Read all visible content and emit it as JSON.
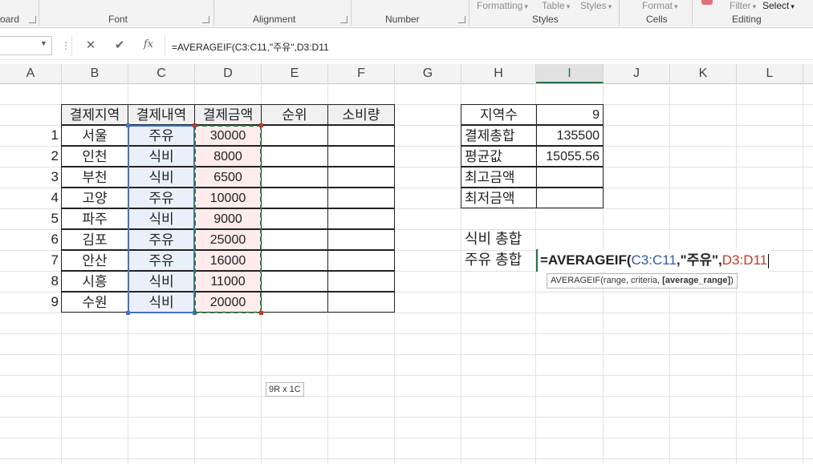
{
  "ribbon": {
    "groups": [
      {
        "label": "oard"
      },
      {
        "label": "Font"
      },
      {
        "label": "Alignment"
      },
      {
        "label": "Number"
      },
      {
        "label": "Styles"
      },
      {
        "label": "Cells"
      },
      {
        "label": "Editing"
      }
    ],
    "styles_buttons": [
      "Formatting",
      "Table",
      "Styles"
    ],
    "cells_button": "Format",
    "editing_buttons": [
      "Filter",
      "Select"
    ]
  },
  "formula_bar": {
    "name_box": "",
    "cancel_glyph": "✕",
    "enter_glyph": "✔",
    "fx_glyph": "fx",
    "formula": "=AVERAGEIF(C3:C11,\"주유\",D3:D11"
  },
  "columns": [
    "A",
    "B",
    "C",
    "D",
    "E",
    "F",
    "G",
    "H",
    "I",
    "J",
    "K",
    "L"
  ],
  "active_column": "I",
  "table": {
    "headers": [
      "결제지역",
      "결제내역",
      "결제금액",
      "순위",
      "소비량"
    ],
    "rows": [
      {
        "no": "1",
        "region": "서울",
        "item": "주유",
        "amount": "30000"
      },
      {
        "no": "2",
        "region": "인천",
        "item": "식비",
        "amount": "8000"
      },
      {
        "no": "3",
        "region": "부천",
        "item": "식비",
        "amount": "6500"
      },
      {
        "no": "4",
        "region": "고양",
        "item": "주유",
        "amount": "10000"
      },
      {
        "no": "5",
        "region": "파주",
        "item": "식비",
        "amount": "9000"
      },
      {
        "no": "6",
        "region": "김포",
        "item": "주유",
        "amount": "25000"
      },
      {
        "no": "7",
        "region": "안산",
        "item": "주유",
        "amount": "16000"
      },
      {
        "no": "8",
        "region": "시흥",
        "item": "식비",
        "amount": "11000"
      },
      {
        "no": "9",
        "region": "수원",
        "item": "식비",
        "amount": "20000"
      }
    ]
  },
  "summary": [
    {
      "label": "지역수",
      "value": "9"
    },
    {
      "label": "결제총합",
      "value": "135500"
    },
    {
      "label": "평균값",
      "value": "15055.56"
    },
    {
      "label": "최고금액",
      "value": ""
    },
    {
      "label": "최저금액",
      "value": ""
    }
  ],
  "extra_labels": {
    "food_total": "식비 총합",
    "fuel_total": "주유 총합"
  },
  "edit_cell": {
    "prefix": "=AVERAGEIF(",
    "range": "C3:C11",
    "comma1": ",",
    "criteria": "\"주유\"",
    "comma2": ",",
    "avg_range": "D3:D11"
  },
  "tooltip": {
    "func": "AVERAGEIF(range, criteria, ",
    "arg": "[average_range]",
    "close": ")"
  },
  "size_tip": "9R x 1C"
}
